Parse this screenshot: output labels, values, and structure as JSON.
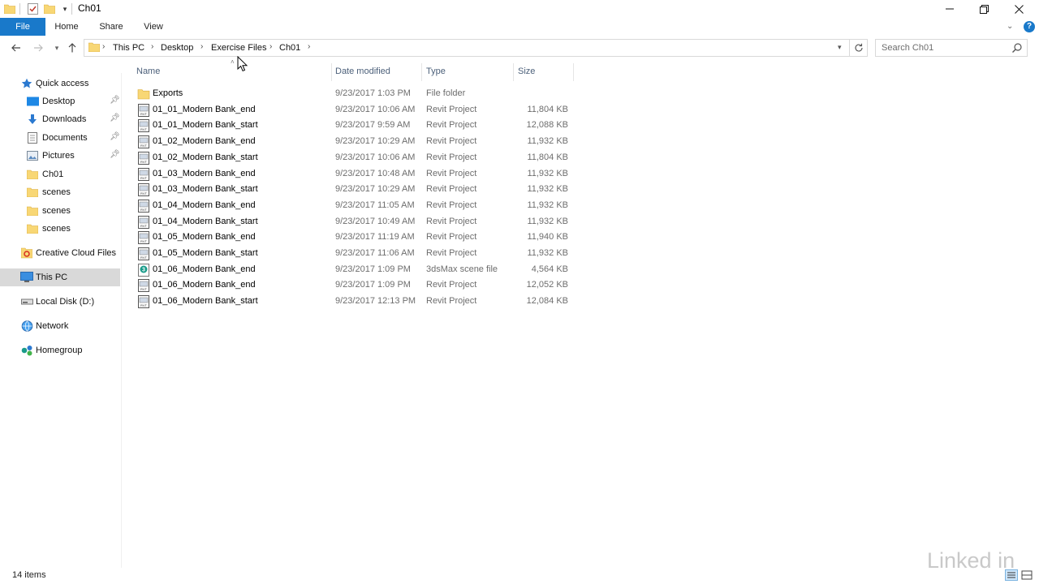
{
  "window": {
    "title": "Ch01"
  },
  "ribbon": {
    "tabs": [
      "File",
      "Home",
      "Share",
      "View"
    ]
  },
  "address": {
    "crumbs": [
      "This PC",
      "Desktop",
      "Exercise Files",
      "Ch01"
    ]
  },
  "search": {
    "placeholder": "Search Ch01"
  },
  "sidebar": {
    "quick_access": "Quick access",
    "items": [
      {
        "label": "Desktop",
        "icon": "desktop-icon",
        "pinned": true
      },
      {
        "label": "Downloads",
        "icon": "download-icon",
        "pinned": true
      },
      {
        "label": "Documents",
        "icon": "documents-icon",
        "pinned": true
      },
      {
        "label": "Pictures",
        "icon": "pictures-icon",
        "pinned": true
      },
      {
        "label": "Ch01",
        "icon": "folder-icon",
        "pinned": false
      },
      {
        "label": "scenes",
        "icon": "folder-icon",
        "pinned": false
      },
      {
        "label": "scenes",
        "icon": "folder-icon",
        "pinned": false
      },
      {
        "label": "scenes",
        "icon": "folder-icon",
        "pinned": false
      }
    ],
    "creative_cloud": "Creative Cloud Files",
    "this_pc": "This PC",
    "local_disk": "Local Disk (D:)",
    "network": "Network",
    "homegroup": "Homegroup"
  },
  "columns": {
    "name": "Name",
    "date": "Date modified",
    "type": "Type",
    "size": "Size"
  },
  "files": [
    {
      "name": "Exports",
      "date": "9/23/2017 1:03 PM",
      "type": "File folder",
      "size": "",
      "icon": "folder"
    },
    {
      "name": "01_01_Modern Bank_end",
      "date": "9/23/2017 10:06 AM",
      "type": "Revit Project",
      "size": "11,804 KB",
      "icon": "rvt"
    },
    {
      "name": "01_01_Modern Bank_start",
      "date": "9/23/2017 9:59 AM",
      "type": "Revit Project",
      "size": "12,088 KB",
      "icon": "rvt"
    },
    {
      "name": "01_02_Modern Bank_end",
      "date": "9/23/2017 10:29 AM",
      "type": "Revit Project",
      "size": "11,932 KB",
      "icon": "rvt"
    },
    {
      "name": "01_02_Modern Bank_start",
      "date": "9/23/2017 10:06 AM",
      "type": "Revit Project",
      "size": "11,804 KB",
      "icon": "rvt"
    },
    {
      "name": "01_03_Modern Bank_end",
      "date": "9/23/2017 10:48 AM",
      "type": "Revit Project",
      "size": "11,932 KB",
      "icon": "rvt"
    },
    {
      "name": "01_03_Modern Bank_start",
      "date": "9/23/2017 10:29 AM",
      "type": "Revit Project",
      "size": "11,932 KB",
      "icon": "rvt"
    },
    {
      "name": "01_04_Modern Bank_end",
      "date": "9/23/2017 11:05 AM",
      "type": "Revit Project",
      "size": "11,932 KB",
      "icon": "rvt"
    },
    {
      "name": "01_04_Modern Bank_start",
      "date": "9/23/2017 10:49 AM",
      "type": "Revit Project",
      "size": "11,932 KB",
      "icon": "rvt"
    },
    {
      "name": "01_05_Modern Bank_end",
      "date": "9/23/2017 11:19 AM",
      "type": "Revit Project",
      "size": "11,940 KB",
      "icon": "rvt"
    },
    {
      "name": "01_05_Modern Bank_start",
      "date": "9/23/2017 11:06 AM",
      "type": "Revit Project",
      "size": "11,932 KB",
      "icon": "rvt"
    },
    {
      "name": "01_06_Modern Bank_end",
      "date": "9/23/2017 1:09 PM",
      "type": "3dsMax scene file",
      "size": "4,564 KB",
      "icon": "max"
    },
    {
      "name": "01_06_Modern Bank_end",
      "date": "9/23/2017 1:09 PM",
      "type": "Revit Project",
      "size": "12,052 KB",
      "icon": "rvt"
    },
    {
      "name": "01_06_Modern Bank_start",
      "date": "9/23/2017 12:13 PM",
      "type": "Revit Project",
      "size": "12,084 KB",
      "icon": "rvt"
    }
  ],
  "status": {
    "item_count": "14 items"
  },
  "watermark": "Linked in",
  "colors": {
    "accent": "#1979ca",
    "folder": "#f8d775",
    "selected_bg": "#d9d9d9"
  }
}
